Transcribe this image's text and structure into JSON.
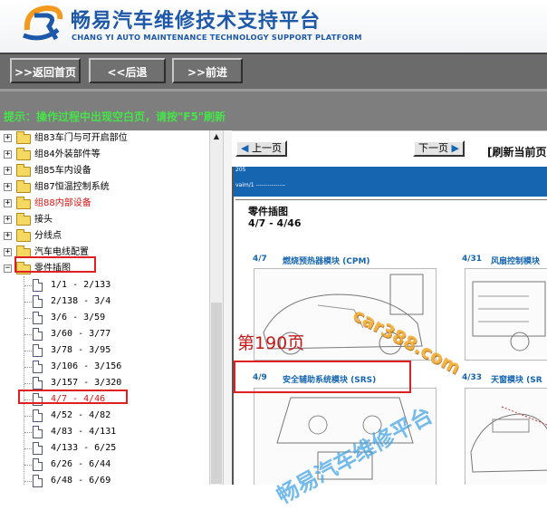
{
  "header": {
    "title_cn": "畅易汽车维修技术支持平台",
    "title_en": "CHANG YI AUTO MAINTENANCE TECHNOLOGY SUPPORT PLATFORM",
    "brand_color": "#1e58a8",
    "logo_icon": "cy-logo-icon"
  },
  "toolbar": {
    "home": ">>返回首页",
    "back": "<<后退",
    "forward": ">>前进"
  },
  "tip": {
    "text": "提示：操作过程中出现空白页，请按\"F5\"刷新",
    "color": "#46e34a"
  },
  "tree": {
    "folders": [
      {
        "label": "组83车门与可开启部位"
      },
      {
        "label": "组84外装部件等"
      },
      {
        "label": "组85车内设备"
      },
      {
        "label": "组87恒温控制系统"
      },
      {
        "label": "组88内部设备"
      },
      {
        "label": "接头"
      },
      {
        "label": "分线点"
      },
      {
        "label": "汽车电线配置"
      },
      {
        "label": "零件插图"
      }
    ],
    "leaves": [
      {
        "label": "1/1 - 2/133"
      },
      {
        "label": "2/138 - 3/4"
      },
      {
        "label": "3/6 - 3/59"
      },
      {
        "label": "3/60 - 3/77"
      },
      {
        "label": "3/78 - 3/95"
      },
      {
        "label": "3/106 - 3/156"
      },
      {
        "label": "3/157 - 3/320"
      },
      {
        "label": "4/7 - 4/46"
      },
      {
        "label": "4/52 - 4/82"
      },
      {
        "label": "4/83 - 4/131"
      },
      {
        "label": "4/133 - 6/25"
      },
      {
        "label": "6/26 - 6/44"
      },
      {
        "label": "6/48 - 6/69"
      }
    ],
    "highlight_color": "#e02020"
  },
  "viewer": {
    "prev": "上一页",
    "next": "下一页",
    "refresh": "[刷新当前页]",
    "doc_small_1": "205",
    "doc_small_2": "vaim/1 ---------------",
    "section_title": "零件插图",
    "section_range": "4/7 - 4/46",
    "items": [
      {
        "num": "4/7",
        "name": "燃烧预热器模块 (CPM)"
      },
      {
        "num": "4/31",
        "name": "风扇控制模块"
      },
      {
        "num": "4/9",
        "name": "安全辅助系统模块 (SRS)"
      },
      {
        "num": "4/33",
        "name": "天窗模块 (SR"
      }
    ],
    "accent": "#1565b0"
  },
  "watermarks": {
    "site": "car388.com",
    "page": "第190页",
    "brand": "畅易汽车维修平台"
  }
}
